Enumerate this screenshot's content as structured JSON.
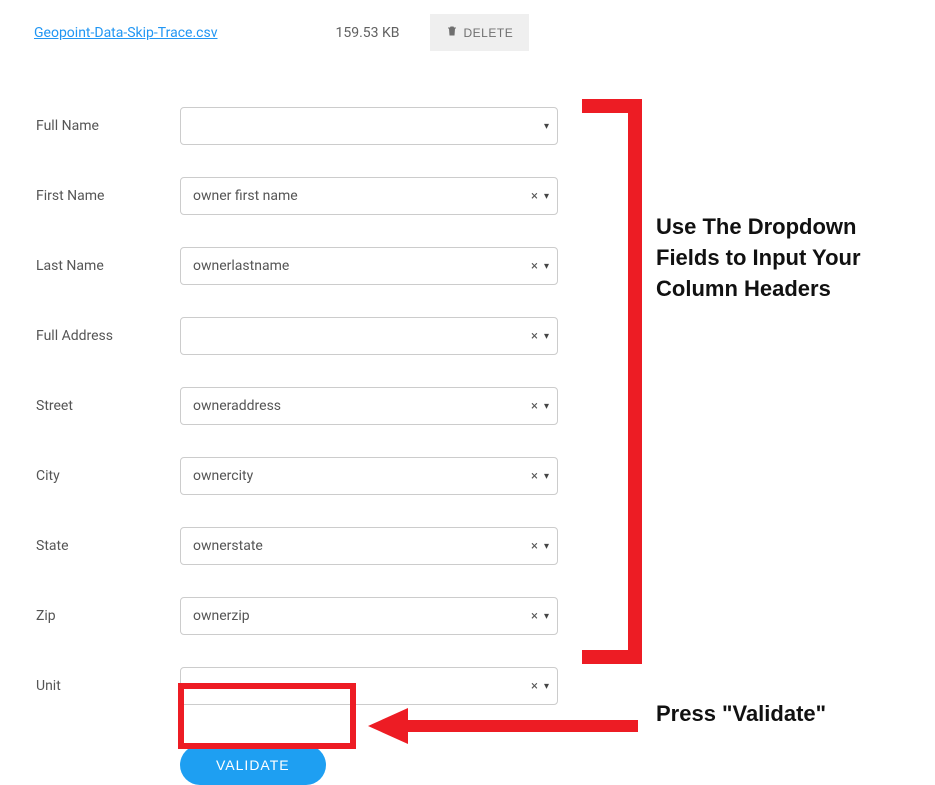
{
  "file": {
    "name": "Geopoint-Data-Skip-Trace.csv",
    "size": "159.53 KB",
    "delete_label": "DELETE"
  },
  "fields": [
    {
      "label": "Full Name",
      "value": "",
      "clearable": false,
      "id": "full-name"
    },
    {
      "label": "First Name",
      "value": "owner first name",
      "clearable": true,
      "id": "first-name"
    },
    {
      "label": "Last Name",
      "value": "ownerlastname",
      "clearable": true,
      "id": "last-name"
    },
    {
      "label": "Full Address",
      "value": "",
      "clearable": true,
      "id": "full-address"
    },
    {
      "label": "Street",
      "value": "owneraddress",
      "clearable": true,
      "id": "street"
    },
    {
      "label": "City",
      "value": "ownercity",
      "clearable": true,
      "id": "city"
    },
    {
      "label": "State",
      "value": "ownerstate",
      "clearable": true,
      "id": "state"
    },
    {
      "label": "Zip",
      "value": "ownerzip",
      "clearable": true,
      "id": "zip"
    },
    {
      "label": "Unit",
      "value": "",
      "clearable": true,
      "id": "unit"
    }
  ],
  "validate_label": "VALIDATE",
  "annotations": {
    "bracket_text": "Use The Dropdown Fields to Input Your Column Headers",
    "arrow_text": "Press \"Validate\""
  }
}
